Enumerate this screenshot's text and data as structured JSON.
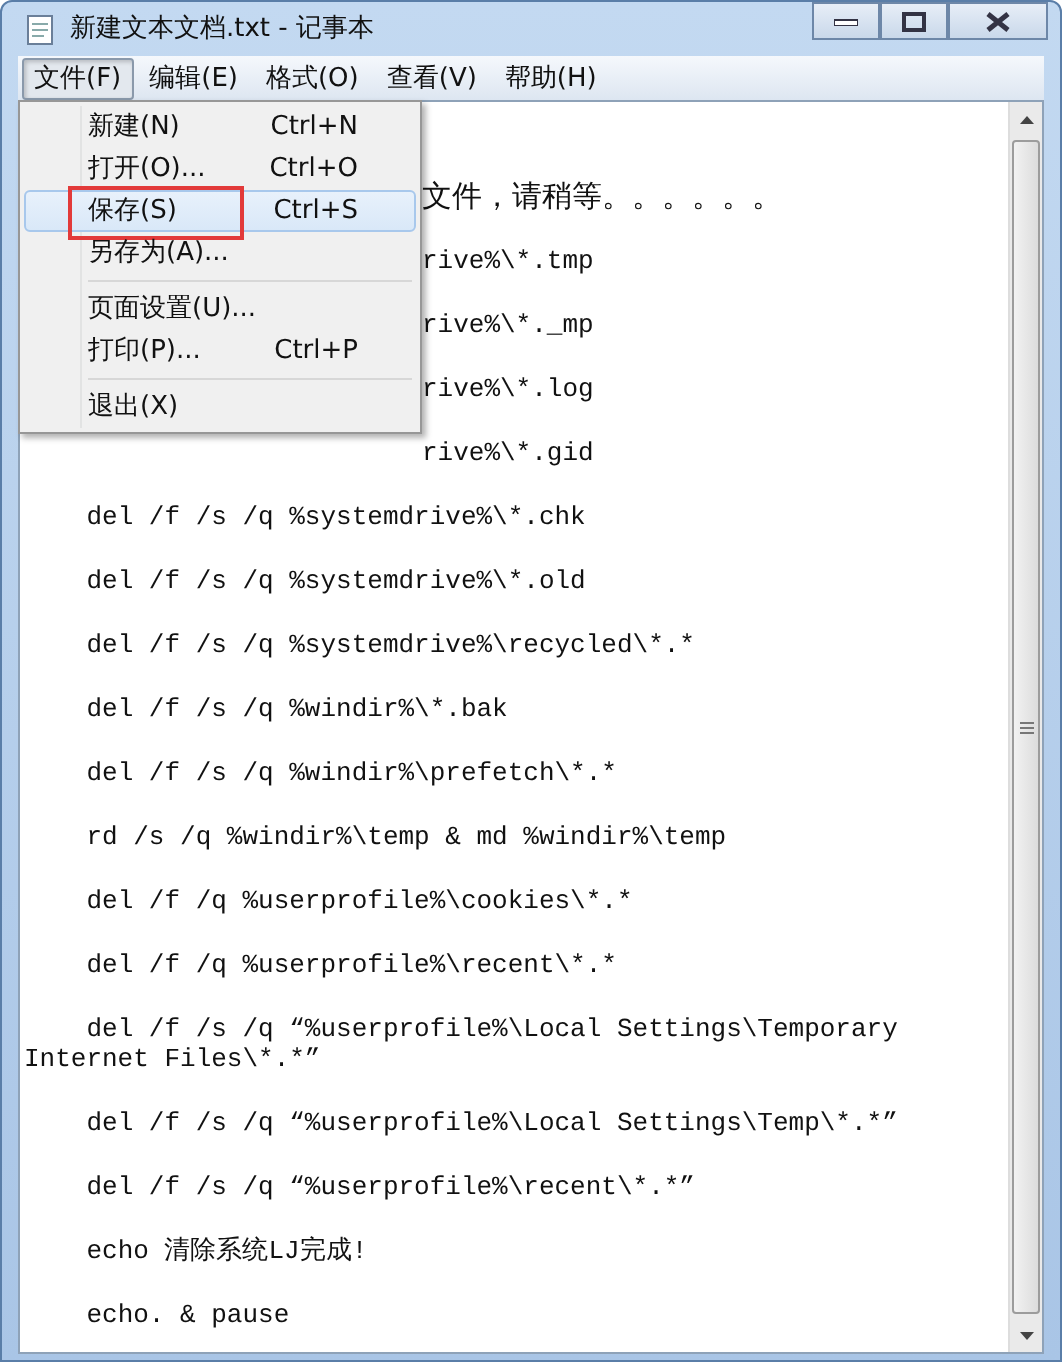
{
  "window": {
    "title": "新建文本文档.txt - 记事本"
  },
  "menu_bar": [
    {
      "label": "文件(F)",
      "selected": true
    },
    {
      "label": "编辑(E)",
      "selected": false
    },
    {
      "label": "格式(O)",
      "selected": false
    },
    {
      "label": "查看(V)",
      "selected": false
    },
    {
      "label": "帮助(H)",
      "selected": false
    }
  ],
  "dropdown": [
    {
      "kind": "item",
      "label": "新建(N)",
      "shortcut": "Ctrl+N",
      "selected": false,
      "marked": false
    },
    {
      "kind": "item",
      "label": "打开(O)...",
      "shortcut": "Ctrl+O",
      "selected": false,
      "marked": false
    },
    {
      "kind": "item",
      "label": "保存(S)",
      "shortcut": "Ctrl+S",
      "selected": true,
      "marked": true
    },
    {
      "kind": "item",
      "label": "另存为(A)...",
      "selected": false,
      "marked": false
    },
    {
      "kind": "separator"
    },
    {
      "kind": "item",
      "label": "页面设置(U)...",
      "selected": false,
      "marked": false
    },
    {
      "kind": "item",
      "label": "打印(P)...",
      "shortcut": "Ctrl+P",
      "selected": false,
      "marked": false
    },
    {
      "kind": "separator"
    },
    {
      "kind": "item",
      "label": "退出(X)",
      "selected": false,
      "marked": false
    }
  ],
  "editor_lines": [
    {
      "kind": "partial",
      "text": "文件，请稍等。。。。。。"
    },
    {
      "kind": "partial",
      "text": "rive%\\*.tmp"
    },
    {
      "kind": "partial",
      "text": "rive%\\*._mp"
    },
    {
      "kind": "partial",
      "text": "rive%\\*.log"
    },
    {
      "kind": "partial",
      "text": "rive%\\*.gid"
    },
    {
      "kind": "full",
      "text": "    del /f /s /q %systemdrive%\\*.chk"
    },
    {
      "kind": "full",
      "text": "    del /f /s /q %systemdrive%\\*.old"
    },
    {
      "kind": "full",
      "text": "    del /f /s /q %systemdrive%\\recycled\\*.*"
    },
    {
      "kind": "full",
      "text": "    del /f /s /q %windir%\\*.bak"
    },
    {
      "kind": "full",
      "text": "    del /f /s /q %windir%\\prefetch\\*.*"
    },
    {
      "kind": "full",
      "text": "    rd /s /q %windir%\\temp & md %windir%\\temp"
    },
    {
      "kind": "full",
      "text": "    del /f /q %userprofile%\\cookies\\*.*"
    },
    {
      "kind": "full",
      "text": "    del /f /q %userprofile%\\recent\\*.*"
    },
    {
      "kind": "full",
      "text": "    del /f /s /q “%userprofile%\\Local Settings\\Temporary Internet Files\\*.*”"
    },
    {
      "kind": "full",
      "text": "    del /f /s /q “%userprofile%\\Local Settings\\Temp\\*.*”"
    },
    {
      "kind": "full",
      "text": "    del /f /s /q “%userprofile%\\recent\\*.*”"
    },
    {
      "kind": "full",
      "text": "    echo 清除系统LJ完成!"
    },
    {
      "kind": "full",
      "text": "    echo. & pause"
    }
  ]
}
